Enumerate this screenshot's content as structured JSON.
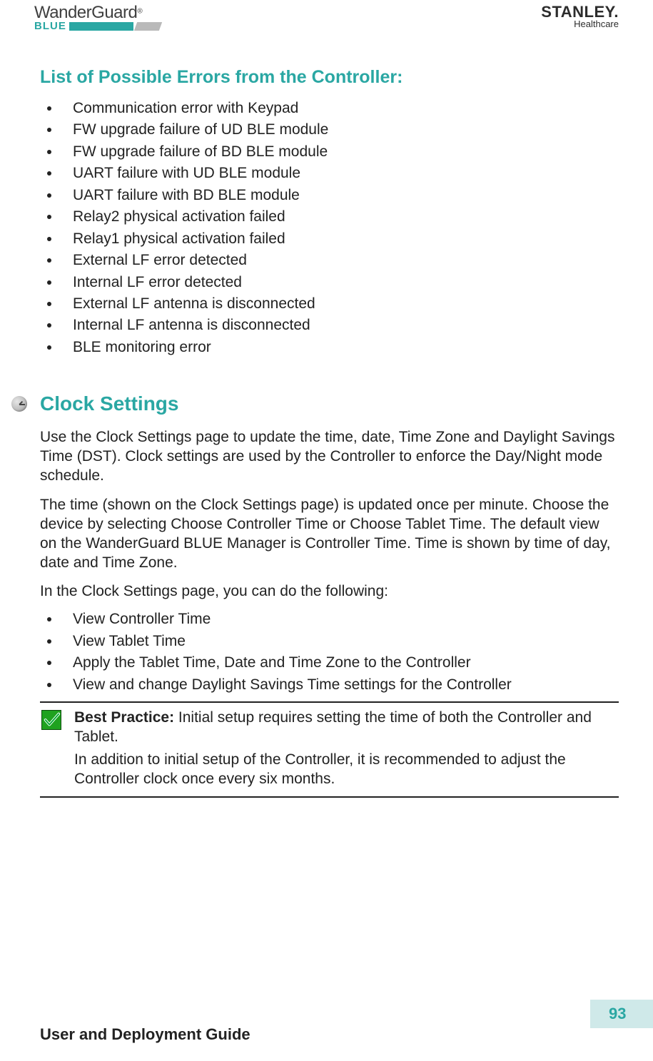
{
  "header": {
    "product_name": "WanderGuard",
    "product_sub": "BLUE",
    "reg_mark": "®",
    "brand_name": "STANLEY",
    "brand_sub": "Healthcare",
    "brand_period": "."
  },
  "section1": {
    "title": "List of Possible Errors from the Controller:",
    "items": [
      "Communication error with Keypad",
      "FW upgrade failure of UD BLE module",
      "FW upgrade failure of BD BLE module",
      "UART failure with UD BLE module",
      "UART failure with BD BLE module",
      "Relay2 physical activation failed",
      "Relay1 physical activation failed",
      "External LF error detected",
      "Internal LF error detected",
      "External LF antenna is disconnected",
      "Internal LF antenna is disconnected",
      "BLE monitoring error"
    ]
  },
  "section2": {
    "title": "Clock Settings",
    "para1": "Use the Clock Settings page to update the time, date, Time Zone and Daylight Savings Time (DST). Clock settings are used by the Controller to enforce the Day/Night mode schedule.",
    "para2": "The time (shown on the Clock Settings page) is updated once per minute. Choose the device by selecting Choose Controller Time or Choose Tablet Time. The default view on the WanderGuard BLUE Manager is Controller Time. Time is shown by time of day, date and Time Zone.",
    "para3": "In the Clock Settings page, you can do the following:",
    "items": [
      "View Controller Time",
      "View Tablet Time",
      "Apply the Tablet Time, Date and Time Zone to the Controller",
      "View and change Daylight Savings Time settings for the Controller"
    ],
    "best_practice": {
      "lead": "Best Practice:",
      "text1": " Initial setup requires setting the time of both the Controller and Tablet.",
      "text2": "In addition to initial setup of the Controller, it is recommended to adjust the Controller clock once every six months."
    }
  },
  "footer": {
    "title": "User and Deployment Guide",
    "page_number": "93"
  }
}
